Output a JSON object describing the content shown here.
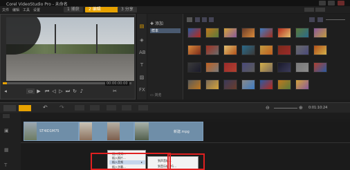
{
  "window": {
    "title": "Corel VideoStudio Pro - 未命名"
  },
  "menu": {
    "items": [
      "文件",
      "编辑",
      "工具",
      "设置"
    ]
  },
  "steps": [
    {
      "num": "1",
      "label": "捕获"
    },
    {
      "num": "2",
      "label": "编辑"
    },
    {
      "num": "3",
      "label": "分享"
    }
  ],
  "preview": {
    "timecode": "00:00:00:00",
    "progress": 0.03
  },
  "library": {
    "add_label": "添加",
    "folder_item": "样本",
    "browse_label": "浏览",
    "thumb_labels": [
      "",
      "",
      "",
      "",
      "",
      "",
      "",
      "",
      "",
      "",
      "",
      "",
      "",
      "",
      "",
      "",
      "",
      "",
      "",
      "",
      "",
      "",
      "",
      "",
      "",
      "",
      "",
      "",
      "",
      "",
      "",
      ""
    ]
  },
  "timeline": {
    "duration": "0:01:10:24",
    "clips": [
      {
        "name": "ST4ID1M75",
        "label_shown": "ST4ID1M75"
      },
      {
        "name": "",
        "label_shown": ""
      },
      {
        "name": "新建.mpg",
        "label_shown": "新建.mpg"
      }
    ]
  },
  "context_menu": {
    "items": [
      "插入视频...",
      "插入照片...",
      "插入音频",
      "插入字幕..."
    ]
  },
  "submenu": {
    "items": [
      "到声音轨...",
      "到音乐轨 #1..."
    ]
  },
  "colors": {
    "accent": "#e7a200",
    "highlight": "#e02020",
    "clip": "#6f8ea8"
  }
}
